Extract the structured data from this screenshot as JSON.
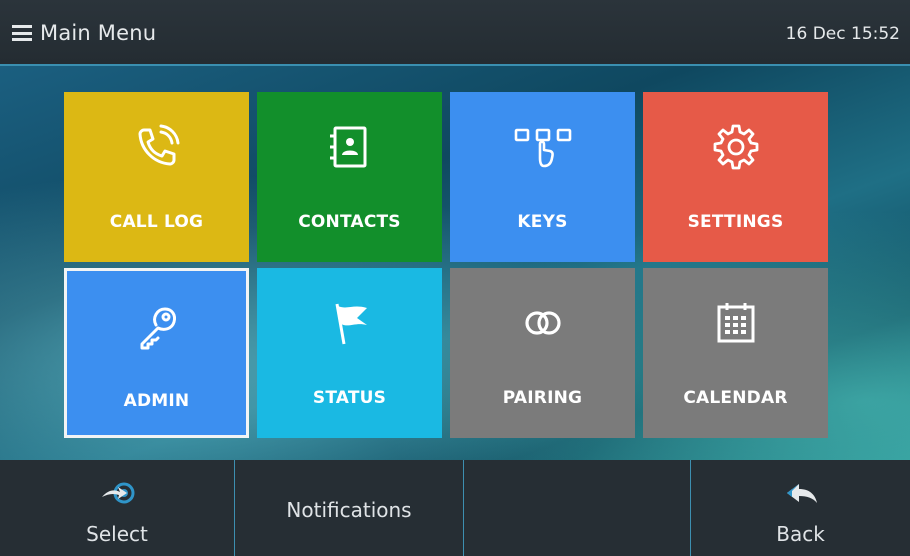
{
  "header": {
    "title": "Main Menu",
    "datetime": "16 Dec 15:52",
    "menu_icon": "menu-icon"
  },
  "tiles": [
    {
      "label": "CALL LOG",
      "color": "#dcb814",
      "icon": "phone-icon"
    },
    {
      "label": "CONTACTS",
      "color": "#128f2b",
      "icon": "contacts-book-icon"
    },
    {
      "label": "KEYS",
      "color": "#3c8ff0",
      "icon": "keys-touch-icon"
    },
    {
      "label": "SETTINGS",
      "color": "#e65a48",
      "icon": "gear-icon"
    },
    {
      "label": "ADMIN",
      "color": "#3c8ff0",
      "icon": "key-icon",
      "selected": true
    },
    {
      "label": "STATUS",
      "color": "#1ab9e3",
      "icon": "flag-icon"
    },
    {
      "label": "PAIRING",
      "color": "#7b7b7b",
      "icon": "pairing-rings-icon"
    },
    {
      "label": "CALENDAR",
      "color": "#7b7b7b",
      "icon": "calendar-icon"
    }
  ],
  "softkeys": [
    {
      "label": "Select",
      "icon": "select-arrow-icon"
    },
    {
      "label": "Notifications"
    },
    {
      "label": ""
    },
    {
      "label": "Back",
      "icon": "back-arrow-icon"
    }
  ]
}
